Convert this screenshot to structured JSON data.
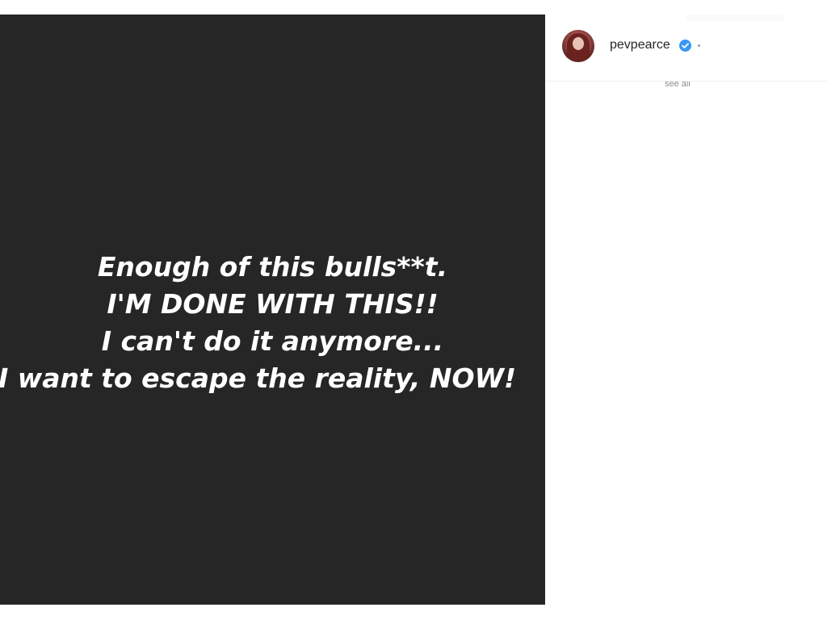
{
  "post": {
    "story_lines": [
      "Enough of this bulls**t.",
      "I'M DONE WITH THIS!!",
      "I can't do it anymore...",
      "I want to escape the reality, NOW!"
    ],
    "background_color": "#262626",
    "text_color": "#ffffff"
  },
  "author": {
    "username": "pevpearce",
    "verified_icon": "verified-badge-icon",
    "separator": "•"
  },
  "comments": {
    "truncated_text": "see all"
  },
  "colors": {
    "verified_blue": "#3897f0",
    "divider": "#efefef"
  }
}
